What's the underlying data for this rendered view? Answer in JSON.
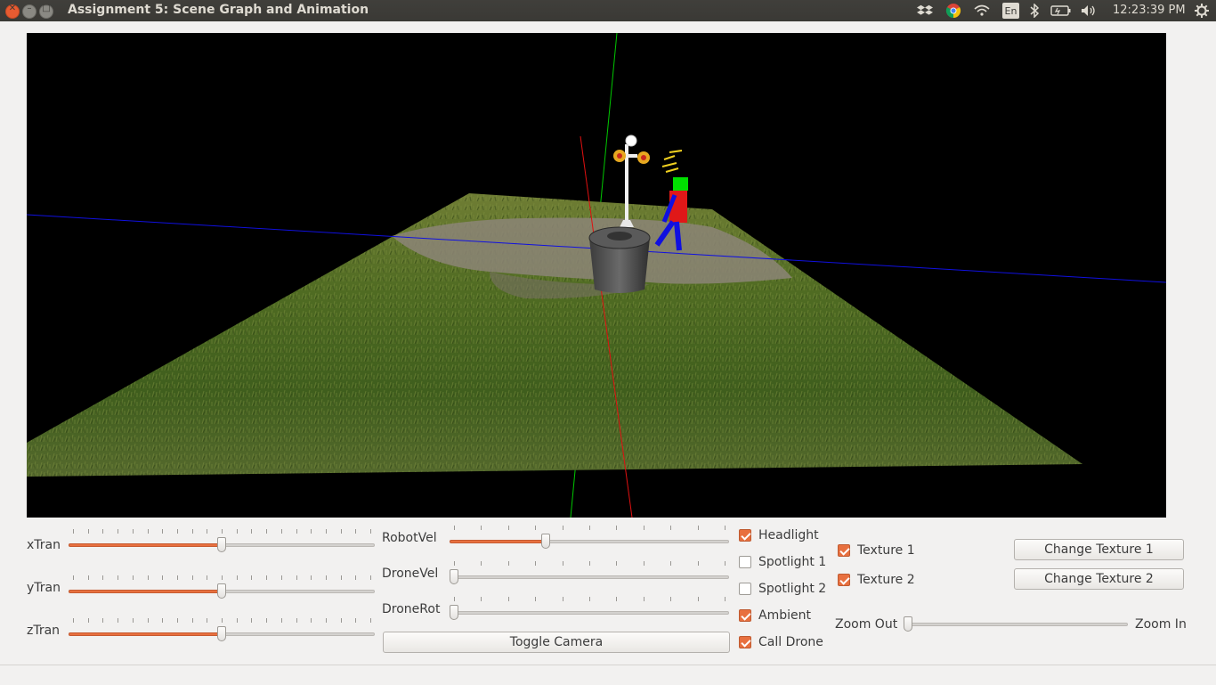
{
  "window": {
    "title": "Assignment 5: Scene Graph and Animation"
  },
  "tray": {
    "language": "En",
    "clock": "12:23:39 PM",
    "icons": [
      "dropbox-icon",
      "chrome-icon",
      "wifi-icon",
      "keyboard-language-icon",
      "bluetooth-icon",
      "battery-icon",
      "volume-icon",
      "gear-icon"
    ]
  },
  "sliders": {
    "xTran": {
      "label": "xTran",
      "value": 0.5
    },
    "yTran": {
      "label": "yTran",
      "value": 0.5
    },
    "zTran": {
      "label": "zTran",
      "value": 0.5
    },
    "robotVel": {
      "label": "RobotVel",
      "value": 0.34
    },
    "droneVel": {
      "label": "DroneVel",
      "value": 0.0
    },
    "droneRot": {
      "label": "DroneRot",
      "value": 0.0
    },
    "zoom": {
      "left_label": "Zoom Out",
      "right_label": "Zoom In",
      "value": 0.0
    }
  },
  "buttons": {
    "toggle_camera": "Toggle Camera",
    "change_texture_1": "Change Texture 1",
    "change_texture_2": "Change Texture 2"
  },
  "checkboxes": {
    "headlight": {
      "label": "Headlight",
      "checked": true
    },
    "spotlight1": {
      "label": "Spotlight 1",
      "checked": false
    },
    "spotlight2": {
      "label": "Spotlight 2",
      "checked": false
    },
    "ambient": {
      "label": "Ambient",
      "checked": true
    },
    "callDrone": {
      "label": "Call Drone",
      "checked": true
    },
    "texture1": {
      "label": "Texture 1",
      "checked": true
    },
    "texture2": {
      "label": "Texture 2",
      "checked": true
    }
  },
  "colors": {
    "accent": "#e8703f",
    "titlebar": "#3a3935",
    "window_bg": "#f2f1f0"
  }
}
